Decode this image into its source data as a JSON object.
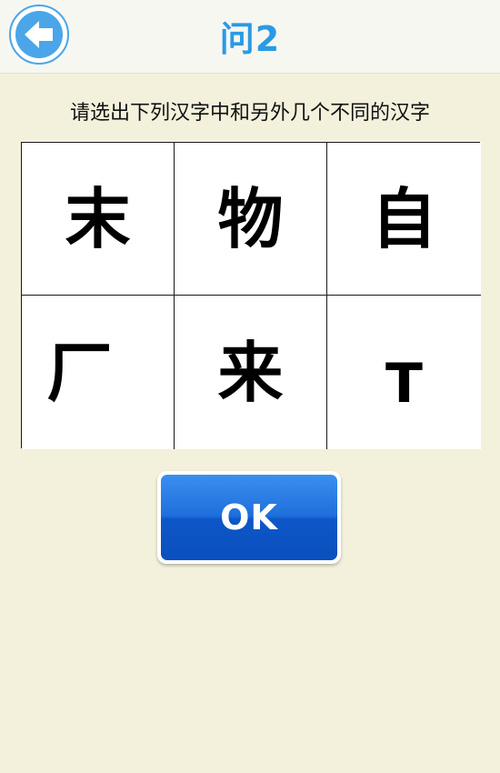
{
  "header": {
    "back_icon": "arrow-left-icon",
    "title": "问2"
  },
  "instruction": "请选出下列汉字中和另外几个不同的汉字",
  "choices": [
    "末",
    "物",
    "自",
    "厂",
    "来",
    "T"
  ],
  "button": {
    "label": "OK"
  },
  "colors": {
    "background": "#f3f0dc",
    "accent": "#2b9ae4",
    "button": "#1f6fdc"
  }
}
